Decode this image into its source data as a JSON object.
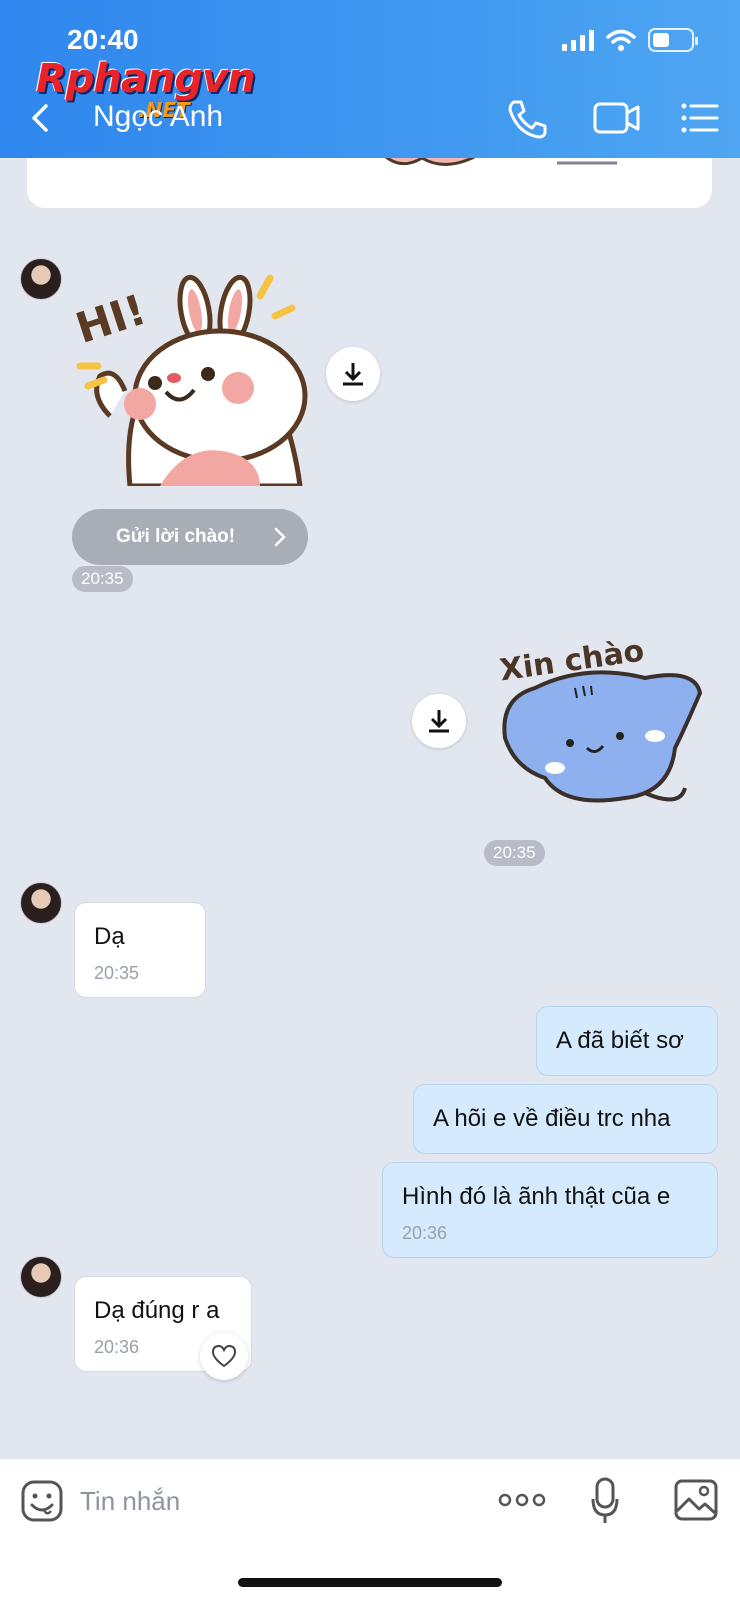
{
  "status_bar": {
    "time": "20:40"
  },
  "watermark": {
    "main": "Rphangvn",
    "sub": ".NET"
  },
  "header": {
    "contact_name": "Ngọc Anh"
  },
  "chat": {
    "greeting_button": "Gửi lời chào!",
    "sticker_in_text": "HI!",
    "sticker_in_time": "20:35",
    "sticker_out_text": "Xin chào",
    "sticker_out_time": "20:35",
    "messages": [
      {
        "direction": "in",
        "text": "Dạ",
        "time": "20:35"
      },
      {
        "direction": "out",
        "text": "A đã biết sơ"
      },
      {
        "direction": "out",
        "text": "A hõi e về điều trc nha"
      },
      {
        "direction": "out",
        "text": "Hình đó là ãnh thật cũa e",
        "time": "20:36"
      },
      {
        "direction": "in",
        "text": "Dạ đúng r a",
        "time": "20:36"
      }
    ]
  },
  "input_bar": {
    "placeholder": "Tin nhắn"
  },
  "icons": {
    "back": "chevron-left-icon",
    "call": "phone-icon",
    "video": "video-icon",
    "menu": "list-icon",
    "download": "download-icon",
    "like": "heart-icon",
    "emoji": "emoji-icon",
    "more": "more-dots-icon",
    "mic": "mic-icon",
    "image": "image-icon"
  },
  "colors": {
    "header_start": "#2f86ee",
    "header_end": "#4ea6f2",
    "chat_bg": "#e2e6ef",
    "out_bubble": "#d5ebfd",
    "in_bubble": "#ffffff"
  }
}
